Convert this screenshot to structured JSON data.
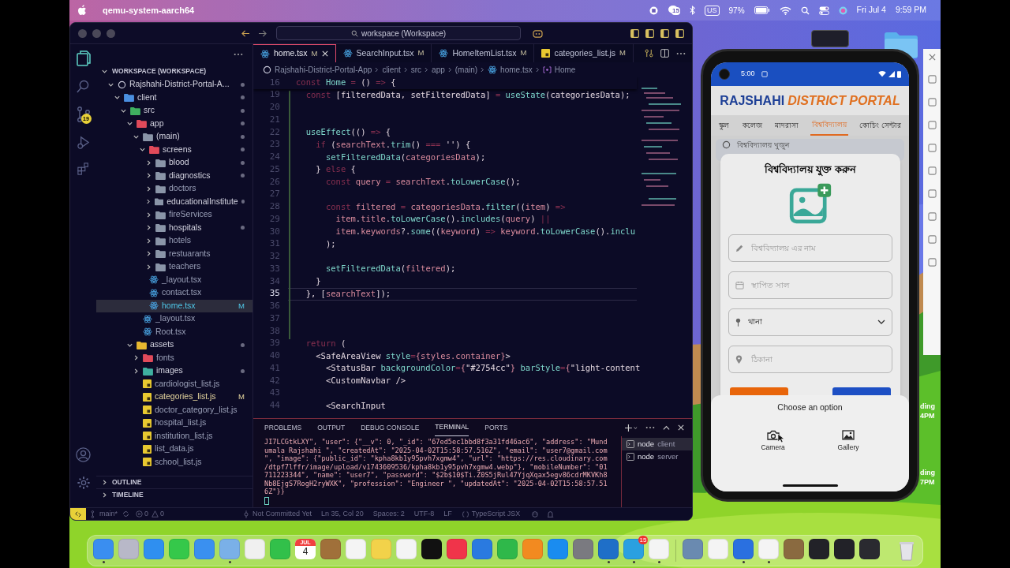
{
  "menu_bar": {
    "app": "qemu-system-aarch64",
    "notification_badge": "15",
    "input_source": "US",
    "battery": "97%",
    "date": "Fri Jul 4",
    "time": "9:59 PM"
  },
  "editor_window": {
    "search": "workspace (Workspace)",
    "source_control_badge": "19",
    "explorer": {
      "header": "WORKSPACE (WORKSPACE)",
      "tree": [
        {
          "label": "Rajshahi-District-Portal-A...",
          "kind": "workspace",
          "expanded": true,
          "dot": true,
          "selected": false,
          "children": [
            {
              "label": "client",
              "kind": "folder",
              "color": "#4a8fe0",
              "expanded": true,
              "dot": true,
              "selected": false,
              "children": [
                {
                  "label": "src",
                  "kind": "folder",
                  "color": "#3fb060",
                  "expanded": true,
                  "dot": true,
                  "selected": false,
                  "children": [
                    {
                      "label": "app",
                      "kind": "folder",
                      "color": "#e04a5a",
                      "expanded": true,
                      "dot": true,
                      "selected": false,
                      "children": [
                        {
                          "label": "(main)",
                          "kind": "folder",
                          "color": "#8a95a8",
                          "expanded": true,
                          "dot": true,
                          "selected": false,
                          "children": [
                            {
                              "label": "screens",
                              "kind": "folder",
                              "color": "#e04a5a",
                              "expanded": true,
                              "dot": true,
                              "selected": false,
                              "children": [
                                {
                                  "label": "blood",
                                  "kind": "folder",
                                  "color": "#8a95a8",
                                  "expanded": false,
                                  "dot": true,
                                  "selected": false
                                },
                                {
                                  "label": "diagnostics",
                                  "kind": "folder",
                                  "color": "#8a95a8",
                                  "expanded": false,
                                  "dot": true,
                                  "selected": false
                                },
                                {
                                  "label": "doctors",
                                  "kind": "folder",
                                  "color": "#8a95a8",
                                  "expanded": false,
                                  "dot": false,
                                  "selected": false
                                },
                                {
                                  "label": "educationalInstitute",
                                  "kind": "folder",
                                  "color": "#8a95a8",
                                  "expanded": false,
                                  "dot": true,
                                  "selected": false
                                },
                                {
                                  "label": "fireServices",
                                  "kind": "folder",
                                  "color": "#8a95a8",
                                  "expanded": false,
                                  "dot": false,
                                  "selected": false
                                },
                                {
                                  "label": "hospitals",
                                  "kind": "folder",
                                  "color": "#8a95a8",
                                  "expanded": false,
                                  "dot": true,
                                  "selected": false
                                },
                                {
                                  "label": "hotels",
                                  "kind": "folder",
                                  "color": "#8a95a8",
                                  "expanded": false,
                                  "dot": false,
                                  "selected": false
                                },
                                {
                                  "label": "restuarants",
                                  "kind": "folder",
                                  "color": "#8a95a8",
                                  "expanded": false,
                                  "dot": false,
                                  "selected": false
                                },
                                {
                                  "label": "teachers",
                                  "kind": "folder",
                                  "color": "#8a95a8",
                                  "expanded": false,
                                  "dot": false,
                                  "selected": false
                                }
                              ]
                            },
                            {
                              "label": "_layout.tsx",
                              "kind": "react",
                              "dot": false,
                              "selected": false
                            },
                            {
                              "label": "contact.tsx",
                              "kind": "react",
                              "dot": false,
                              "selected": false
                            },
                            {
                              "label": "home.tsx",
                              "kind": "react",
                              "dot": false,
                              "selected": true,
                              "decoration": "M"
                            }
                          ]
                        },
                        {
                          "label": "_layout.tsx",
                          "kind": "react",
                          "dot": false,
                          "selected": false
                        },
                        {
                          "label": "Root.tsx",
                          "kind": "react",
                          "dot": false,
                          "selected": false
                        }
                      ]
                    },
                    {
                      "label": "assets",
                      "kind": "folder",
                      "color": "#e8b830",
                      "expanded": true,
                      "dot": true,
                      "selected": false,
                      "children": [
                        {
                          "label": "fonts",
                          "kind": "folder",
                          "color": "#e04a5a",
                          "expanded": false,
                          "dot": false,
                          "selected": false
                        },
                        {
                          "label": "images",
                          "kind": "folder",
                          "color": "#3fb0a0",
                          "expanded": false,
                          "dot": true,
                          "selected": false
                        },
                        {
                          "label": "cardiologist_list.js",
                          "kind": "js",
                          "dot": false,
                          "selected": false
                        },
                        {
                          "label": "categories_list.js",
                          "kind": "js",
                          "dot": false,
                          "selected": false,
                          "decoration": "M"
                        },
                        {
                          "label": "doctor_category_list.js",
                          "kind": "js",
                          "dot": false,
                          "selected": false
                        },
                        {
                          "label": "hospital_list.js",
                          "kind": "js",
                          "dot": false,
                          "selected": false
                        },
                        {
                          "label": "institution_list.js",
                          "kind": "js",
                          "dot": false,
                          "selected": false
                        },
                        {
                          "label": "list_data.js",
                          "kind": "js",
                          "dot": false,
                          "selected": false
                        },
                        {
                          "label": "school_list.js",
                          "kind": "js",
                          "dot": false,
                          "selected": false
                        }
                      ]
                    }
                  ]
                }
              ]
            }
          ]
        }
      ],
      "sections": [
        "OUTLINE",
        "TIMELINE"
      ]
    },
    "tabs": [
      {
        "label": "home.tsx",
        "kind": "react",
        "decoration": "M",
        "selected": true
      },
      {
        "label": "SearchInput.tsx",
        "kind": "react",
        "decoration": "M",
        "selected": false
      },
      {
        "label": "HomeItemList.tsx",
        "kind": "react",
        "decoration": "M",
        "selected": false
      },
      {
        "label": "categories_list.js",
        "kind": "js",
        "decoration": "M",
        "selected": false
      }
    ],
    "breadcrumb": [
      "Rajshahi-District-Portal-App",
      "client",
      "src",
      "app",
      "(main)",
      "home.tsx",
      "Home"
    ],
    "sticky_line": {
      "number": "16",
      "tokens": [
        {
          "text": "const ",
          "kind": "kw"
        },
        {
          "text": "Home",
          "kind": "fn"
        },
        {
          "text": " = ",
          "kind": "kw"
        },
        {
          "text": "() ",
          "kind": "text"
        },
        {
          "text": "=> ",
          "kind": "kw"
        },
        {
          "text": "{",
          "kind": "text"
        }
      ]
    },
    "code": [
      {
        "number": "19",
        "current": false,
        "tokens": [
          {
            "text": "  const ",
            "kind": "kw"
          },
          {
            "text": "[filteredData, setFilteredData] ",
            "kind": "text"
          },
          {
            "text": "= ",
            "kind": "kw"
          },
          {
            "text": "useState",
            "kind": "fn"
          },
          {
            "text": "(categoriesData);",
            "kind": "text"
          }
        ]
      },
      {
        "number": "20",
        "current": false
      },
      {
        "number": "21",
        "current": false
      },
      {
        "number": "22",
        "current": false,
        "tokens": [
          {
            "text": "  useEffect",
            "kind": "fn"
          },
          {
            "text": "(() ",
            "kind": "text"
          },
          {
            "text": "=> ",
            "kind": "kw"
          },
          {
            "text": "{",
            "kind": "text"
          }
        ]
      },
      {
        "number": "23",
        "current": false,
        "tokens": [
          {
            "text": "    if ",
            "kind": "kw"
          },
          {
            "text": "(",
            "kind": "text"
          },
          {
            "text": "searchText",
            "kind": "var"
          },
          {
            "text": ".",
            "kind": "text"
          },
          {
            "text": "trim",
            "kind": "fn"
          },
          {
            "text": "() ",
            "kind": "text"
          },
          {
            "text": "=== ",
            "kind": "kw"
          },
          {
            "text": "''",
            "kind": "text"
          },
          {
            "text": ") {",
            "kind": "text"
          }
        ]
      },
      {
        "number": "24",
        "current": false,
        "tokens": [
          {
            "text": "      setFilteredData",
            "kind": "fn"
          },
          {
            "text": "(",
            "kind": "text"
          },
          {
            "text": "categoriesData",
            "kind": "var"
          },
          {
            "text": ");",
            "kind": "text"
          }
        ]
      },
      {
        "number": "25",
        "current": false,
        "tokens": [
          {
            "text": "    } ",
            "kind": "text"
          },
          {
            "text": "else ",
            "kind": "kw"
          },
          {
            "text": "{",
            "kind": "text"
          }
        ]
      },
      {
        "number": "26",
        "current": false,
        "tokens": [
          {
            "text": "      const ",
            "kind": "kw"
          },
          {
            "text": "query ",
            "kind": "var"
          },
          {
            "text": "= ",
            "kind": "kw"
          },
          {
            "text": "searchText",
            "kind": "var"
          },
          {
            "text": ".",
            "kind": "text"
          },
          {
            "text": "toLowerCase",
            "kind": "fn"
          },
          {
            "text": "();",
            "kind": "text"
          }
        ]
      },
      {
        "number": "27",
        "current": false
      },
      {
        "number": "28",
        "current": false,
        "tokens": [
          {
            "text": "      const ",
            "kind": "kw"
          },
          {
            "text": "filtered ",
            "kind": "var"
          },
          {
            "text": "= ",
            "kind": "kw"
          },
          {
            "text": "categoriesData",
            "kind": "var"
          },
          {
            "text": ".",
            "kind": "text"
          },
          {
            "text": "filter",
            "kind": "fn"
          },
          {
            "text": "((",
            "kind": "text"
          },
          {
            "text": "item",
            "kind": "var"
          },
          {
            "text": ") ",
            "kind": "text"
          },
          {
            "text": "=>",
            "kind": "kw"
          }
        ]
      },
      {
        "number": "29",
        "current": false,
        "tokens": [
          {
            "text": "        item",
            "kind": "var"
          },
          {
            "text": ".",
            "kind": "text"
          },
          {
            "text": "title",
            "kind": "var"
          },
          {
            "text": ".",
            "kind": "text"
          },
          {
            "text": "toLowerCase",
            "kind": "fn"
          },
          {
            "text": "().",
            "kind": "text"
          },
          {
            "text": "includes",
            "kind": "fn"
          },
          {
            "text": "(",
            "kind": "text"
          },
          {
            "text": "query",
            "kind": "var"
          },
          {
            "text": ") ",
            "kind": "text"
          },
          {
            "text": "||",
            "kind": "kw"
          }
        ]
      },
      {
        "number": "30",
        "current": false,
        "tokens": [
          {
            "text": "        item",
            "kind": "var"
          },
          {
            "text": ".",
            "kind": "text"
          },
          {
            "text": "keywords",
            "kind": "var"
          },
          {
            "text": "?.",
            "kind": "text"
          },
          {
            "text": "some",
            "kind": "fn"
          },
          {
            "text": "((",
            "kind": "text"
          },
          {
            "text": "keyword",
            "kind": "var"
          },
          {
            "text": ") ",
            "kind": "text"
          },
          {
            "text": "=> ",
            "kind": "kw"
          },
          {
            "text": "keyword",
            "kind": "var"
          },
          {
            "text": ".",
            "kind": "text"
          },
          {
            "text": "toLowerCase",
            "kind": "fn"
          },
          {
            "text": "().",
            "kind": "text"
          },
          {
            "text": "inclu",
            "kind": "fn"
          }
        ]
      },
      {
        "number": "31",
        "current": false,
        "tokens": [
          {
            "text": "      );",
            "kind": "text"
          }
        ]
      },
      {
        "number": "32",
        "current": false
      },
      {
        "number": "33",
        "current": false,
        "tokens": [
          {
            "text": "      setFilteredData",
            "kind": "fn"
          },
          {
            "text": "(",
            "kind": "text"
          },
          {
            "text": "filtered",
            "kind": "var"
          },
          {
            "text": ");",
            "kind": "text"
          }
        ]
      },
      {
        "number": "34",
        "current": false,
        "tokens": [
          {
            "text": "    }",
            "kind": "text"
          }
        ]
      },
      {
        "number": "35",
        "current": true,
        "tokens": [
          {
            "text": "  }, [",
            "kind": "text"
          },
          {
            "text": "searchText",
            "kind": "var"
          },
          {
            "text": "]);",
            "kind": "text"
          }
        ]
      },
      {
        "number": "36",
        "current": false
      },
      {
        "number": "37",
        "current": false
      },
      {
        "number": "38",
        "current": false
      },
      {
        "number": "39",
        "current": false,
        "tokens": [
          {
            "text": "  return ",
            "kind": "kw"
          },
          {
            "text": "(",
            "kind": "text"
          }
        ]
      },
      {
        "number": "40",
        "current": false,
        "tokens": [
          {
            "text": "    <SafeAreaView ",
            "kind": "text"
          },
          {
            "text": "style",
            "kind": "fn"
          },
          {
            "text": "=",
            "kind": "kw"
          },
          {
            "text": "{styles.container}",
            "kind": "var"
          },
          {
            "text": ">",
            "kind": "text"
          }
        ]
      },
      {
        "number": "41",
        "current": false,
        "tokens": [
          {
            "text": "      <StatusBar ",
            "kind": "text"
          },
          {
            "text": "backgroundColor",
            "kind": "fn"
          },
          {
            "text": "=",
            "kind": "kw"
          },
          {
            "text": "{",
            "kind": "var"
          },
          {
            "text": "\"#2754cc\"",
            "kind": "text"
          },
          {
            "text": "} ",
            "kind": "var"
          },
          {
            "text": "barStyle",
            "kind": "fn"
          },
          {
            "text": "=",
            "kind": "kw"
          },
          {
            "text": "{",
            "kind": "var"
          },
          {
            "text": "\"light-content",
            "kind": "text"
          }
        ]
      },
      {
        "number": "42",
        "current": false,
        "tokens": [
          {
            "text": "      <CustomNavbar />",
            "kind": "text"
          }
        ]
      },
      {
        "number": "43",
        "current": false
      },
      {
        "number": "44",
        "current": false,
        "tokens": [
          {
            "text": "      <SearchInput",
            "kind": "text"
          }
        ]
      }
    ],
    "panel_tabs": [
      {
        "label": "PROBLEMS",
        "selected": false
      },
      {
        "label": "OUTPUT",
        "selected": false
      },
      {
        "label": "DEBUG CONSOLE",
        "selected": false
      },
      {
        "label": "TERMINAL",
        "selected": true
      },
      {
        "label": "PORTS",
        "selected": false
      }
    ],
    "terminal_lines": [
      "JI7LCGtkLXY\", \"user\": {\"__v\": 0, \"_id\": \"67ed5ec1bbd8f3a31fd46ac6\", \"address\": \"Mund",
      "umala Rajshahi \", \"createdAt\": \"2025-04-02T15:58:57.516Z\", \"email\": \"user7@gmail.com",
      "\", \"image\": {\"public_id\": \"kpha8kb1y95pvh7xgmw4\", \"url\": \"https://res.cloudinary.com",
      "/dtpf7lffr/image/upload/v1743609536/kpha8kb1y95pvh7xgmw4.webp\"}, \"mobileNumber\": \"01",
      "711223344\", \"name\": \"user7\", \"password\": \"$2b$10$Ti.Z0S5jRul47YjqXqax5egv86cdrMKVKh8",
      "Nb8EjgS7RogH2ryWXK\", \"profession\": \"Engineer \", \"updatedAt\": \"2025-04-02T15:58:57.51",
      "6Z\"}}"
    ],
    "terminals": [
      {
        "command": "node",
        "name": "client",
        "selected": true
      },
      {
        "command": "node",
        "name": "server",
        "selected": false
      }
    ],
    "status_bar": {
      "branch": "main*",
      "errors": "0",
      "warnings": "0",
      "blame": "Not Committed Yet",
      "position": "Ln 35, Col 20",
      "indent": "Spaces: 2",
      "encoding": "UTF-8",
      "eol": "LF",
      "language": "TypeScript JSX"
    }
  },
  "phone": {
    "time": "5:00",
    "title_primary": "RAJSHAHI",
    "title_accent": "DISTRICT PORTAL",
    "tabs": [
      {
        "label": "স্কুল",
        "selected": false
      },
      {
        "label": "কলেজ",
        "selected": false
      },
      {
        "label": "মাদরাসা",
        "selected": false
      },
      {
        "label": "বিশ্ববিদ্যালয়",
        "selected": true
      },
      {
        "label": "কোচিং সেন্টার",
        "selected": false
      }
    ],
    "search": {
      "placeholder": "বিশ্ববিদ্যালয় খুজুন"
    },
    "dialog": {
      "title": "বিশ্ববিদ্যালয় যুক্ত করুন",
      "fields": [
        {
          "kind": "text",
          "placeholder": "বিশ্ববিদ্যালয় এর নাম"
        },
        {
          "kind": "text",
          "placeholder": "স্থাপিত সাল"
        },
        {
          "kind": "select",
          "value": "থানা"
        },
        {
          "kind": "text",
          "placeholder": "ঠিকানা"
        }
      ],
      "buttons": [
        {
          "color": "#e8650a"
        },
        {
          "color": "#1d4fc4"
        }
      ]
    },
    "sheet": {
      "title": "Choose an option",
      "options": [
        {
          "label": "Camera"
        },
        {
          "label": "Gallery"
        }
      ]
    }
  },
  "desktop_fragments": [
    "ding",
    "4PM",
    "ding",
    "7PM"
  ],
  "dock": {
    "apps": [
      {
        "color": "#3a8ef0",
        "running": true
      },
      {
        "color": "#b8b8c8",
        "running": false
      },
      {
        "color": "#2f8ff0",
        "running": false
      },
      {
        "color": "#35c84a",
        "running": false
      },
      {
        "color": "#3a90f0",
        "running": false
      },
      {
        "color": "#7ab0e8",
        "running": true
      },
      {
        "color": "#f0f0f0",
        "running": false
      },
      {
        "color": "#32c04a",
        "running": false
      },
      {
        "kind": "calendar",
        "month": "JUL",
        "day": "4",
        "running": false
      },
      {
        "color": "#a0703a",
        "running": false
      },
      {
        "color": "#f4f4f4",
        "running": false
      },
      {
        "color": "#f2d24a",
        "running": false
      },
      {
        "color": "#f4f4f4",
        "running": false
      },
      {
        "color": "#111111",
        "running": false
      },
      {
        "color": "#f0344a",
        "running": false
      },
      {
        "color": "#2a7ae0",
        "running": false
      },
      {
        "color": "#2fb84a",
        "running": false
      },
      {
        "color": "#f28a20",
        "running": false
      },
      {
        "color": "#1a8cf0",
        "running": false
      },
      {
        "color": "#7a7a80",
        "running": false
      },
      {
        "color": "#1f6fc8",
        "running": true
      },
      {
        "color": "#2aa0e0",
        "running": true,
        "badge": "15"
      },
      {
        "color": "#f4f4f4",
        "running": true
      }
    ],
    "recents": [
      {
        "color": "#6a8ab0",
        "running": false
      },
      {
        "color": "#f4f4f4",
        "running": false
      },
      {
        "color": "#2a70e0",
        "running": true
      },
      {
        "color": "#f4f4f4",
        "running": true
      },
      {
        "color": "#8a6a40",
        "running": false
      },
      {
        "color": "#222228",
        "running": false
      },
      {
        "color": "#222228",
        "running": false
      },
      {
        "color": "#2a2a30",
        "running": false
      }
    ]
  }
}
